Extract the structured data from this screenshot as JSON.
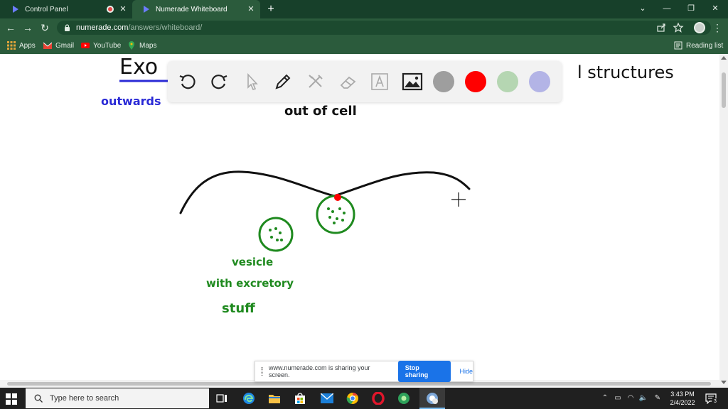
{
  "tabs": [
    {
      "title": "Control Panel",
      "close": "✕"
    },
    {
      "title": "Numerade Whiteboard",
      "close": "✕"
    }
  ],
  "new_tab": "+",
  "window_controls": {
    "minimize": "—",
    "restore": "❐",
    "close": "✕",
    "tab_search": "⌄"
  },
  "nav": {
    "back": "←",
    "forward": "→",
    "reload": "↻"
  },
  "address": {
    "domain": "numerade.com",
    "path": "/answers/whiteboard/"
  },
  "bookmarks": [
    {
      "label": "Apps"
    },
    {
      "label": "Gmail"
    },
    {
      "label": "YouTube"
    },
    {
      "label": "Maps"
    }
  ],
  "reading_list": "Reading list",
  "whiteboard": {
    "tools": [
      "undo-icon",
      "redo-icon",
      "pointer-icon",
      "pen-icon",
      "tools-icon",
      "eraser-icon",
      "text-icon",
      "image-icon"
    ],
    "colors": [
      "#9e9e9e",
      "#ff0000",
      "#b5d6b2",
      "#b3b4e6"
    ],
    "handwriting": {
      "heading": "Exo",
      "heading_right": "l structures",
      "outward": "outwards",
      "out_of_cell": "out   of   cell",
      "vesicle": "vesicle",
      "with": "with  excretory",
      "stuff": "stuff"
    },
    "ink_colors": {
      "black": "#111111",
      "green": "#1f8a1f",
      "blue": "#2a2ad6",
      "red": "#ff0000"
    }
  },
  "sharebar": {
    "message": "www.numerade.com is sharing your screen.",
    "stop": "Stop sharing",
    "hide": "Hide"
  },
  "taskbar": {
    "search_placeholder": "Type here to search",
    "time": "3:43 PM",
    "date": "2/4/2022",
    "notifications": "3"
  }
}
